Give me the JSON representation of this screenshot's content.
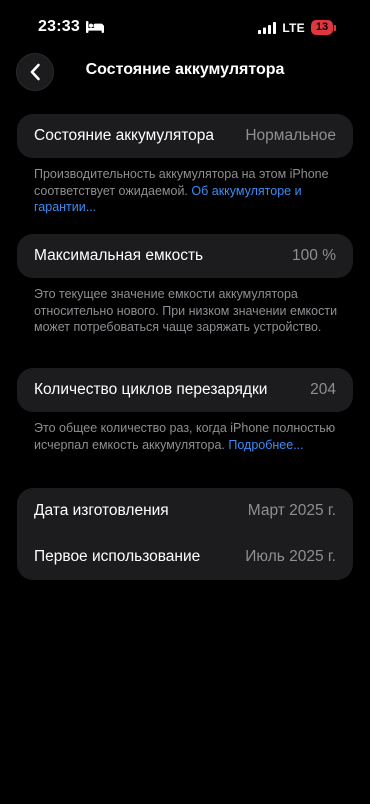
{
  "status_bar": {
    "time": "23:33",
    "network": "LTE",
    "battery_level": "13",
    "bed_icon": "bed-icon",
    "signal_icon": "cellular-signal-icon"
  },
  "nav": {
    "back_icon": "chevron-left-icon",
    "title": "Состояние аккумулятора"
  },
  "health": {
    "label": "Состояние аккумулятора",
    "value": "Нормальное",
    "note": "Производительность аккумулятора на этом iPhone соответствует ожидаемой.",
    "link": "Об аккумуляторе и гарантии..."
  },
  "capacity": {
    "label": "Максимальная емкость",
    "value": "100 %",
    "note": "Это текущее значение емкости аккумулятора относительно нового. При низком значении емкости может потребоваться чаще заряжать устройство."
  },
  "cycles": {
    "label": "Количество циклов перезарядки",
    "value": "204",
    "note": "Это общее количество раз, когда iPhone полностью исчерпал емкость аккумулятора.",
    "link": "Подробнее..."
  },
  "dates": {
    "manufacture_label": "Дата изготовления",
    "manufacture_value": "Март 2025 г.",
    "first_use_label": "Первое использование",
    "first_use_value": "Июль 2025 г."
  },
  "colors": {
    "background": "#000000",
    "card": "#1c1c1e",
    "secondary_text": "#8e8e93",
    "link": "#3b8cf5",
    "battery_low": "#e0363f"
  }
}
